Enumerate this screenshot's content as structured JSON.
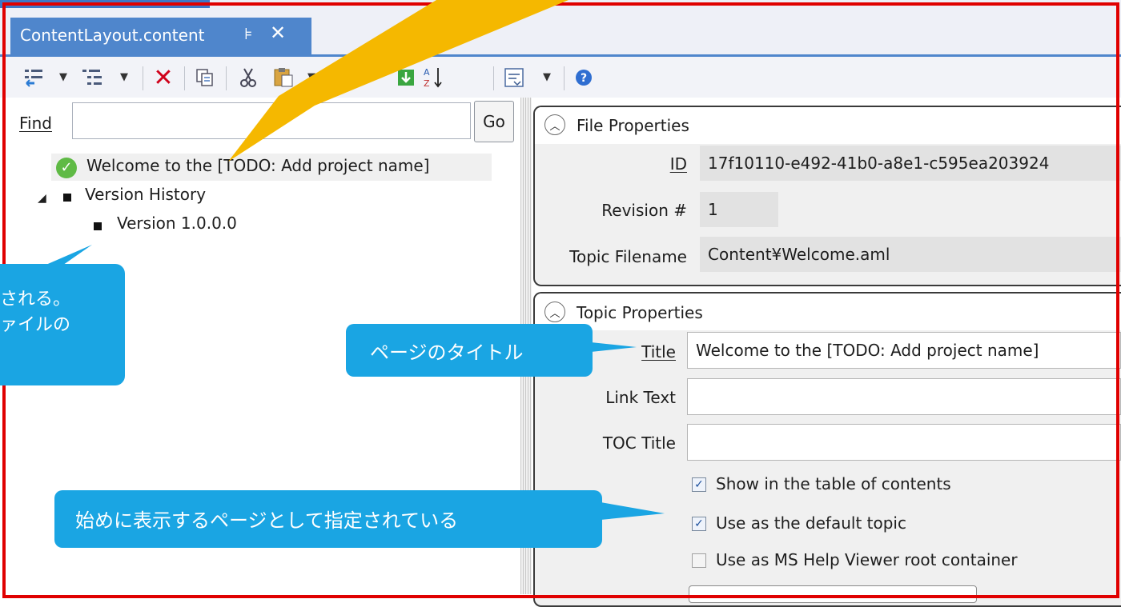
{
  "tab": {
    "title": "ContentLayout.content",
    "pin_glyph": "⊧",
    "close_glyph": "✕"
  },
  "toolbar": {
    "icons": [
      "add-sibling-icon",
      "add-child-icon",
      "delete-icon",
      "copy-icon",
      "cut-icon",
      "paste-icon",
      "move-up-icon",
      "move-down-icon",
      "sort-icon",
      "expand-collapse-icon",
      "help-icon"
    ]
  },
  "find": {
    "label": "Find",
    "value": "",
    "go_label": "Go"
  },
  "tree": {
    "items": [
      {
        "label": "Welcome to the [TODO: Add project name]"
      },
      {
        "label": "Version History"
      },
      {
        "label": "Version 1.0.0.0"
      }
    ]
  },
  "file_properties": {
    "title": "File Properties",
    "id_label": "ID",
    "id_value": "17f10110-e492-41b0-a8e1-c595ea203924",
    "revision_label": "Revision #",
    "revision_value": "1",
    "filename_label": "Topic Filename",
    "filename_value": "Content¥Welcome.aml"
  },
  "topic_properties": {
    "title": "Topic Properties",
    "title_label": "Title",
    "title_value": "Welcome to the [TODO: Add project name]",
    "link_text_label": "Link Text",
    "link_text_value": "",
    "toc_title_label": "TOC Title",
    "toc_title_value": "",
    "checkboxes": [
      {
        "label": "Show in the table of contents",
        "checked": true
      },
      {
        "label": "Use as the default topic",
        "checked": true
      },
      {
        "label": "Use as MS Help Viewer root container",
        "checked": false
      }
    ]
  },
  "callouts": {
    "left_line1": "される。",
    "left_line2": "ァイルの",
    "title_callout": "ページのタイトル",
    "default_callout": "始めに表示するページとして指定されている"
  },
  "colors": {
    "accent": "#4f86cc",
    "callout": "#1aa5e3",
    "highlight_arrow": "#f5b800",
    "frame": "#e00000"
  }
}
